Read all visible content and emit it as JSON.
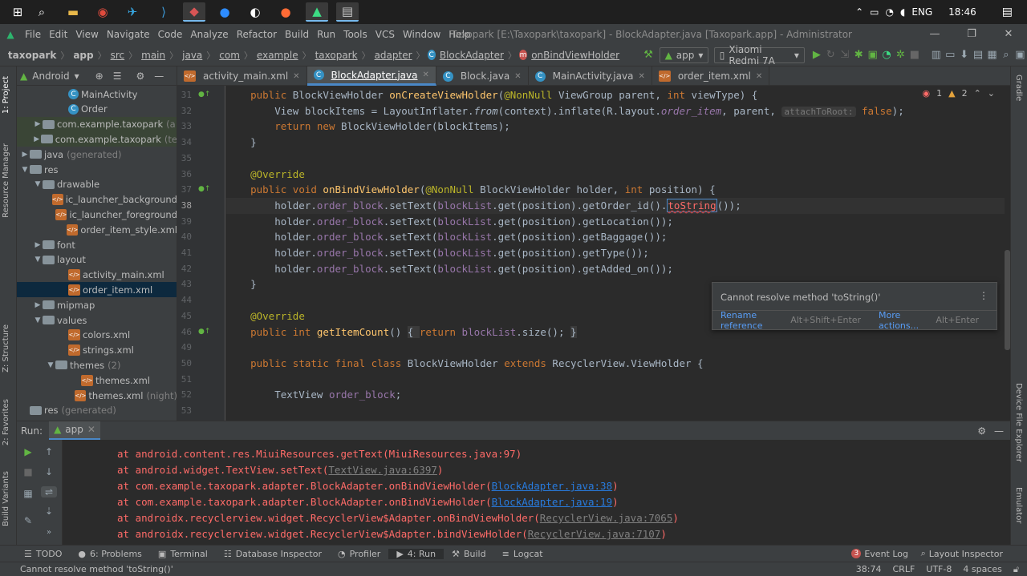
{
  "menubar": {
    "items": [
      {
        "label": "File"
      },
      {
        "label": "Edit"
      },
      {
        "label": "View"
      },
      {
        "label": "Navigate"
      },
      {
        "label": "Code"
      },
      {
        "label": "Analyze"
      },
      {
        "label": "Refactor"
      },
      {
        "label": "Build"
      },
      {
        "label": "Run"
      },
      {
        "label": "Tools"
      },
      {
        "label": "VCS"
      },
      {
        "label": "Window"
      },
      {
        "label": "Help"
      }
    ],
    "title": "Taxopark [E:\\Taxopark\\taxopark] - BlockAdapter.java [Taxopark.app] - Administrator"
  },
  "tray": {
    "lang": "ENG",
    "time": "18:46"
  },
  "breadcrumbs": [
    "taxopark",
    "app",
    "src",
    "main",
    "java",
    "com",
    "example",
    "taxopark",
    "adapter",
    "BlockAdapter",
    "onBindViewHolder"
  ],
  "toolbar": {
    "config": "app",
    "device": "Xiaomi Redmi 7A"
  },
  "project": {
    "view": "Android",
    "rows": [
      {
        "label": "MainActivity",
        "type": "cls",
        "indent": 4,
        "arrow": ""
      },
      {
        "label": "Order",
        "type": "cls",
        "indent": 4,
        "arrow": ""
      },
      {
        "label": "com.example.taxopark",
        "suffix": "(a",
        "type": "pkg",
        "indent": 2,
        "arrow": "▶",
        "hl": true
      },
      {
        "label": "com.example.taxopark",
        "suffix": "(te",
        "type": "pkg",
        "indent": 2,
        "arrow": "▶",
        "hl": true
      },
      {
        "label": "java",
        "suffix": "(generated)",
        "type": "folder",
        "indent": 1,
        "arrow": "▶"
      },
      {
        "label": "res",
        "type": "folder",
        "indent": 1,
        "arrow": "▼"
      },
      {
        "label": "drawable",
        "type": "folder",
        "indent": 2,
        "arrow": "▼"
      },
      {
        "label": "ic_launcher_background",
        "type": "xml",
        "indent": 4,
        "arrow": ""
      },
      {
        "label": "ic_launcher_foreground",
        "type": "xml",
        "indent": 4,
        "arrow": ""
      },
      {
        "label": "order_item_style.xml",
        "type": "xml",
        "indent": 4,
        "arrow": ""
      },
      {
        "label": "font",
        "type": "folder",
        "indent": 2,
        "arrow": "▶"
      },
      {
        "label": "layout",
        "type": "folder",
        "indent": 2,
        "arrow": "▼"
      },
      {
        "label": "activity_main.xml",
        "type": "xml",
        "indent": 4,
        "arrow": ""
      },
      {
        "label": "order_item.xml",
        "type": "xml",
        "indent": 4,
        "arrow": "",
        "sel": true
      },
      {
        "label": "mipmap",
        "type": "folder",
        "indent": 2,
        "arrow": "▶"
      },
      {
        "label": "values",
        "type": "folder",
        "indent": 2,
        "arrow": "▼"
      },
      {
        "label": "colors.xml",
        "type": "xml",
        "indent": 4,
        "arrow": ""
      },
      {
        "label": "strings.xml",
        "type": "xml",
        "indent": 4,
        "arrow": ""
      },
      {
        "label": "themes",
        "suffix": "(2)",
        "type": "folder",
        "indent": 3,
        "arrow": "▼"
      },
      {
        "label": "themes.xml",
        "type": "xml",
        "indent": 5,
        "arrow": ""
      },
      {
        "label": "themes.xml",
        "suffix": "(night)",
        "type": "xml",
        "indent": 5,
        "arrow": ""
      },
      {
        "label": "res",
        "suffix": "(generated)",
        "type": "folder",
        "indent": 1,
        "arrow": ""
      }
    ]
  },
  "tabs": [
    {
      "label": "activity_main.xml",
      "icon": "xml"
    },
    {
      "label": "BlockAdapter.java",
      "icon": "cls",
      "active": true
    },
    {
      "label": "Block.java",
      "icon": "cls"
    },
    {
      "label": "MainActivity.java",
      "icon": "cls"
    },
    {
      "label": "order_item.xml",
      "icon": "xml"
    }
  ],
  "editor": {
    "errors": "1",
    "warnings": "2",
    "line_numbers": [
      "31",
      "32",
      "33",
      "34",
      "35",
      "36",
      "37",
      "38",
      "39",
      "40",
      "41",
      "42",
      "43",
      "44",
      "45",
      "46",
      "49",
      "50",
      "51",
      "52",
      "53"
    ]
  },
  "popup": {
    "message": "Cannot resolve method 'toString()'",
    "action1": "Rename reference",
    "short1": "Alt+Shift+Enter",
    "action2": "More actions...",
    "short2": "Alt+Enter"
  },
  "run": {
    "label": "Run:",
    "tab": "app",
    "lines": [
      {
        "pre": "at android.content.res.MiuiResources.getText(MiuiResources.java:97)",
        "link": "",
        "post": "",
        "lt": ""
      },
      {
        "pre": "at android.widget.TextView.setText(",
        "link": "TextView.java:6397",
        "post": ")",
        "lt": "g"
      },
      {
        "pre": "at com.example.taxopark.adapter.BlockAdapter.onBindViewHolder(",
        "link": "BlockAdapter.java:38",
        "post": ")",
        "lt": "u"
      },
      {
        "pre": "at com.example.taxopark.adapter.BlockAdapter.onBindViewHolder(",
        "link": "BlockAdapter.java:19",
        "post": ")",
        "lt": "u"
      },
      {
        "pre": "at androidx.recyclerview.widget.RecyclerView$Adapter.onBindViewHolder(",
        "link": "RecyclerView.java:7065",
        "post": ")",
        "lt": "g"
      },
      {
        "pre": "at androidx.recyclerview.widget.RecyclerView$Adapter.bindViewHolder(",
        "link": "RecyclerView.java:7107",
        "post": ")",
        "lt": "g"
      }
    ]
  },
  "bottomtabs": [
    {
      "label": "TODO",
      "icon": "☰"
    },
    {
      "label": "6: Problems",
      "icon": "●"
    },
    {
      "label": "Terminal",
      "icon": "▣"
    },
    {
      "label": "Database Inspector",
      "icon": "☷"
    },
    {
      "label": "Profiler",
      "icon": "◔"
    },
    {
      "label": "4: Run",
      "icon": "▶",
      "on": true
    },
    {
      "label": "Build",
      "icon": "⚒"
    },
    {
      "label": "Logcat",
      "icon": "≡"
    }
  ],
  "bottomright": {
    "eventlog": "Event Log",
    "eventcount": "3",
    "layoutinspector": "Layout Inspector"
  },
  "status": {
    "message": "Cannot resolve method 'toString()'",
    "pos": "38:74",
    "crlf": "CRLF",
    "enc": "UTF-8",
    "indent": "4 spaces"
  },
  "sidetabs": {
    "project": "1: Project",
    "resource": "Resource Manager",
    "structure": "Z: Structure",
    "favorites": "2: Favorites",
    "variants": "Build Variants",
    "gradle": "Gradle",
    "dfe": "Device File Explorer",
    "emulator": "Emulator"
  }
}
